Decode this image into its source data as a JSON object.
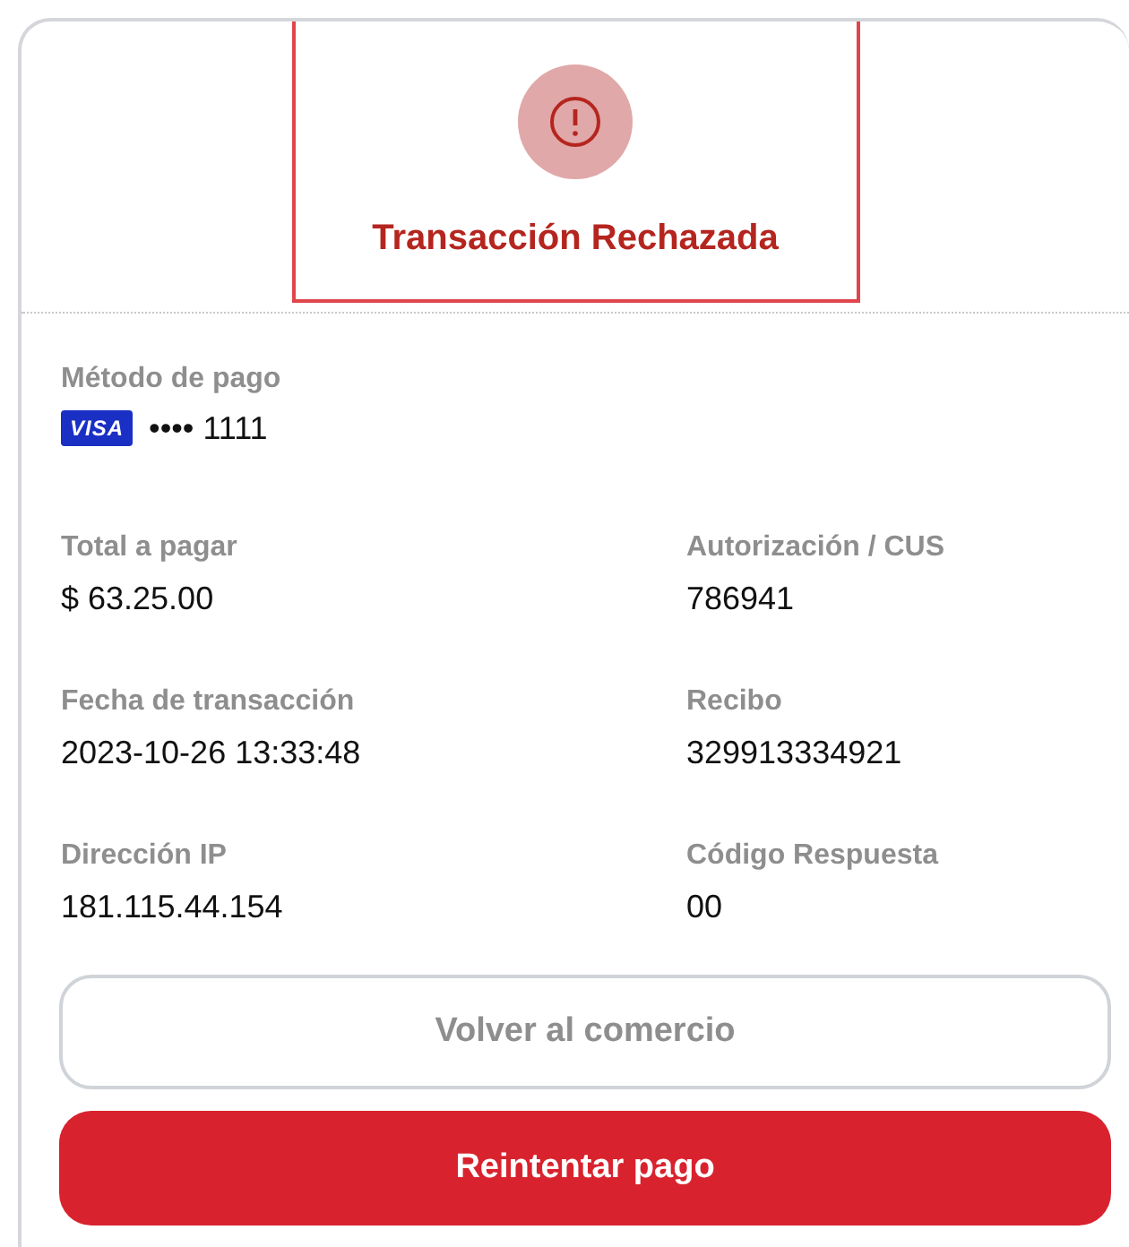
{
  "status": {
    "kind": "error",
    "title": "Transacción Rechazada"
  },
  "payment_method": {
    "label": "Método de pago",
    "brand_text": "VISA",
    "masked_number": "•••• 1111"
  },
  "fields": [
    {
      "label": "Total a pagar",
      "value": "$ 63.25.00"
    },
    {
      "label": "Autorización / CUS",
      "value": "786941"
    },
    {
      "label": "Fecha de transacción",
      "value": "2023-10-26 13:33:48"
    },
    {
      "label": "Recibo",
      "value": "329913334921"
    },
    {
      "label": "Dirección IP",
      "value": "181.115.44.154"
    },
    {
      "label": "Código Respuesta",
      "value": "00"
    }
  ],
  "buttons": [
    {
      "label": "Volver al comercio",
      "kind": "secondary"
    },
    {
      "label": "Reintentar pago",
      "kind": "primary"
    }
  ]
}
